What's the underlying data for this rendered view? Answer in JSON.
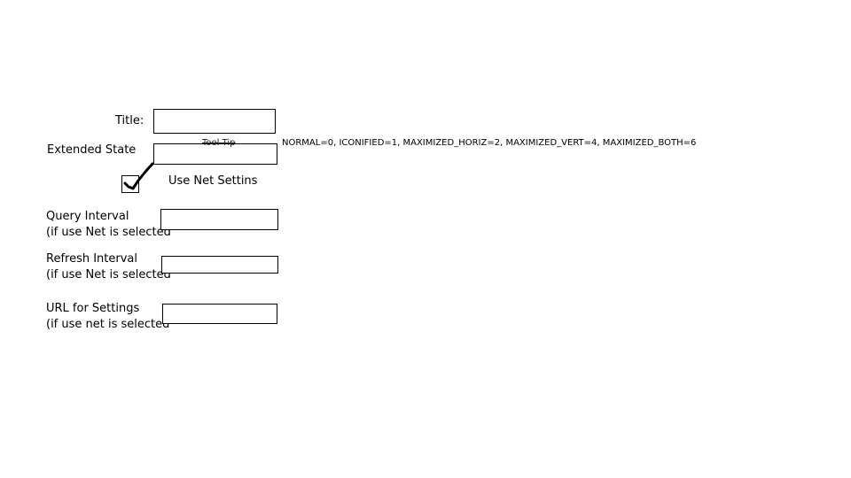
{
  "form": {
    "title_label": "Title:",
    "title_value": "",
    "extended_state_label": "Extended State",
    "extended_state_value": "",
    "tooltip_label": "Tool Tip",
    "state_hint": "NORMAL=0, ICONIFIED=1, MAXIMIZED_HORIZ=2, MAXIMIZED_VERT=4, MAXIMIZED_BOTH=6",
    "use_net_label": "Use Net Settins",
    "use_net_checked": true,
    "query_interval_label": "Query Interval",
    "query_interval_note": "(if use Net is selected",
    "query_interval_value": "",
    "refresh_interval_label": "Refresh Interval",
    "refresh_interval_note": "(if use Net is selected",
    "refresh_interval_value": "",
    "url_label": "URL for Settings",
    "url_note": "(if use net is selected",
    "url_value": ""
  }
}
